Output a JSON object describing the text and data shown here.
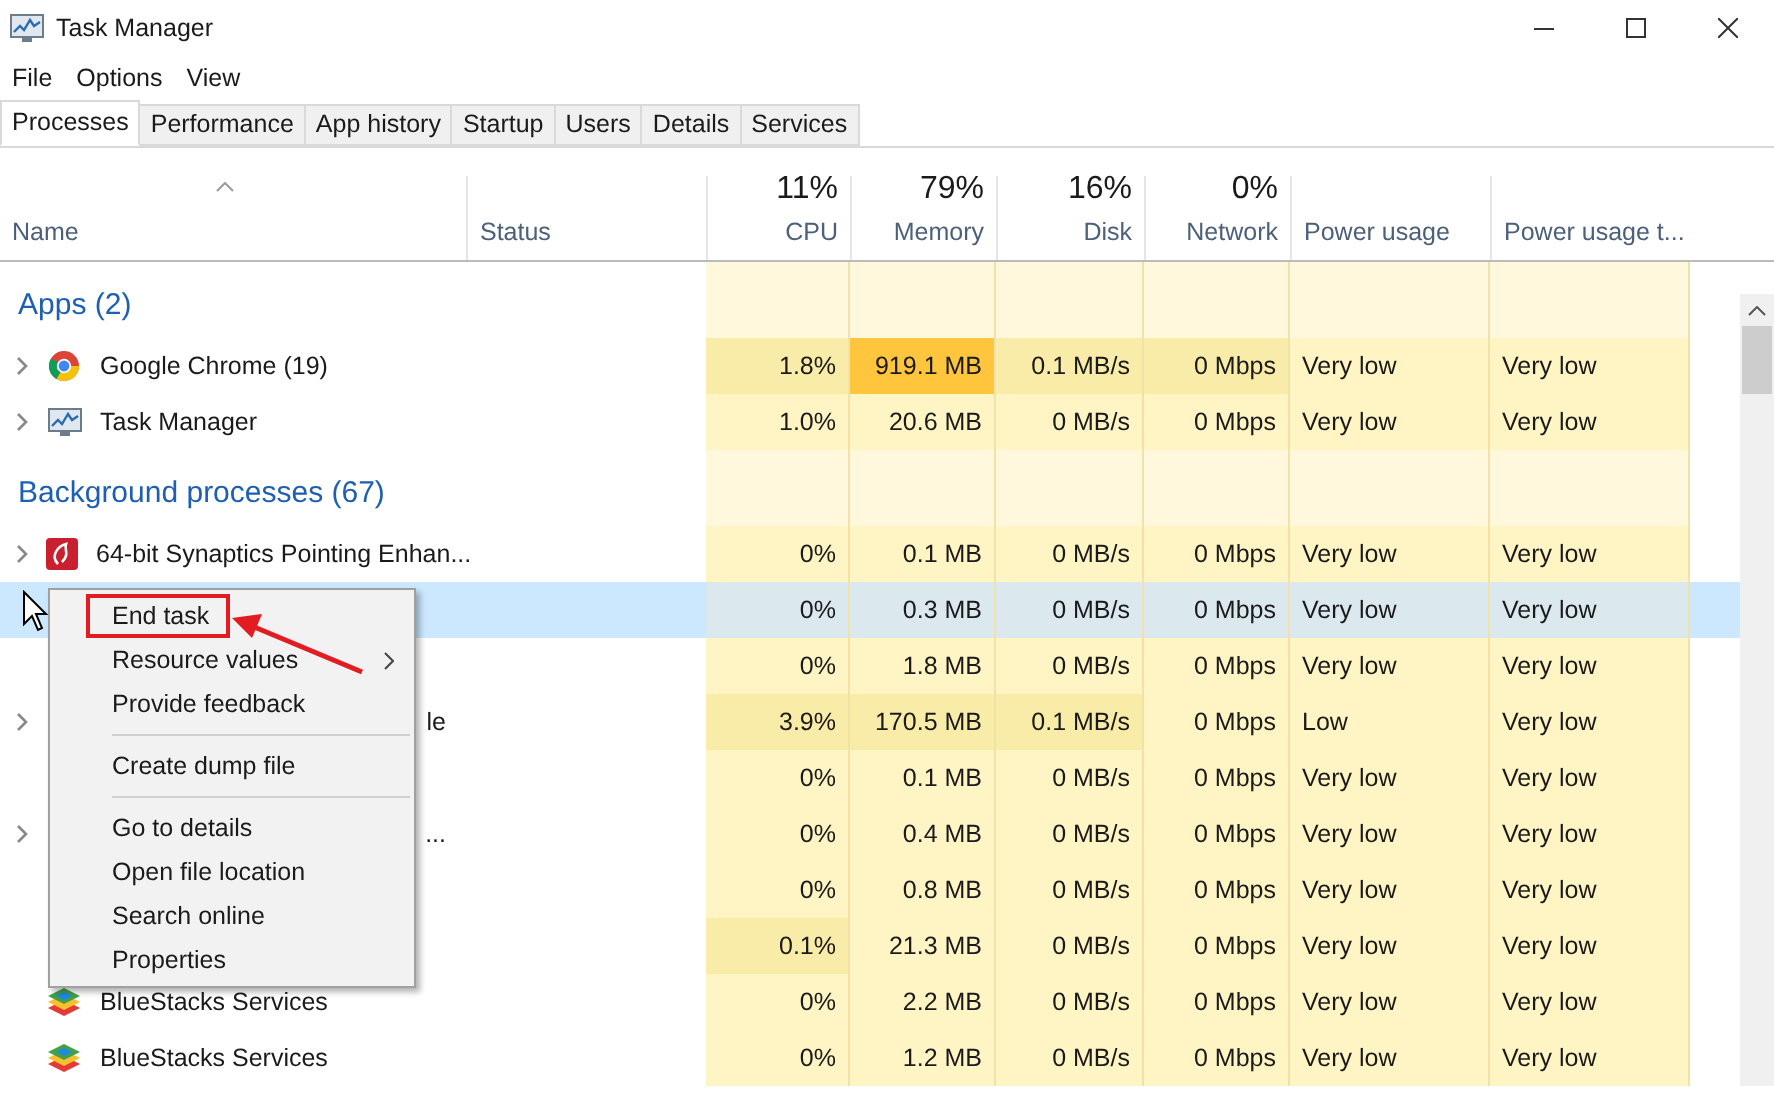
{
  "window": {
    "title": "Task Manager"
  },
  "menu": [
    "File",
    "Options",
    "View"
  ],
  "tabs": [
    {
      "label": "Processes",
      "selected": true
    },
    {
      "label": "Performance",
      "selected": false
    },
    {
      "label": "App history",
      "selected": false
    },
    {
      "label": "Startup",
      "selected": false
    },
    {
      "label": "Users",
      "selected": false
    },
    {
      "label": "Details",
      "selected": false
    },
    {
      "label": "Services",
      "selected": false
    }
  ],
  "columns": [
    {
      "label": "Name"
    },
    {
      "label": "Status"
    },
    {
      "summary": "11%",
      "label": "CPU"
    },
    {
      "summary": "79%",
      "label": "Memory"
    },
    {
      "summary": "16%",
      "label": "Disk"
    },
    {
      "summary": "0%",
      "label": "Network"
    },
    {
      "label": "Power usage"
    },
    {
      "label": "Power usage t..."
    }
  ],
  "groups": [
    {
      "title": "Apps (2)",
      "rows": [
        {
          "kind": "browser",
          "name": "Google Chrome (19)",
          "expandable": true,
          "selected": false,
          "cells": [
            {
              "text": "1.8%",
              "busy": true,
              "peak": false
            },
            {
              "text": "919.1 MB",
              "peak": true
            },
            {
              "text": "0.1 MB/s",
              "busy": true,
              "peak": false
            },
            {
              "text": "0 Mbps",
              "busy": true,
              "peak": false
            },
            {
              "text": "Very low",
              "busy": false,
              "peak": false
            },
            {
              "text": "Very low",
              "busy": false,
              "peak": false
            }
          ]
        },
        {
          "kind": "monitor",
          "name": "Task Manager",
          "expandable": true,
          "selected": false,
          "cells": [
            {
              "text": "1.0%",
              "busy": false,
              "peak": false
            },
            {
              "text": "20.6 MB",
              "busy": false,
              "peak": false
            },
            {
              "text": "0 MB/s",
              "busy": false,
              "peak": false
            },
            {
              "text": "0 Mbps",
              "busy": false,
              "peak": false
            },
            {
              "text": "Very low",
              "busy": false,
              "peak": false
            },
            {
              "text": "Very low",
              "busy": false,
              "peak": false
            }
          ]
        }
      ]
    },
    {
      "title": "Background processes (67)",
      "rows": [
        {
          "kind": "driver",
          "name": "64-bit Synaptics Pointing Enhan...",
          "expandable": true,
          "selected": false,
          "cells": [
            {
              "text": "0%",
              "busy": false,
              "peak": false
            },
            {
              "text": "0.1 MB",
              "busy": false,
              "peak": false
            },
            {
              "text": "0 MB/s",
              "busy": false,
              "peak": false
            },
            {
              "text": "0 Mbps",
              "busy": false,
              "peak": false
            },
            {
              "text": "Very low",
              "busy": false,
              "peak": false
            },
            {
              "text": "Very low",
              "busy": false,
              "peak": false
            }
          ]
        },
        {
          "kind": "covered",
          "expandable": false,
          "selected": true,
          "cells": [
            {
              "text": "0%"
            },
            {
              "text": "0.3 MB"
            },
            {
              "text": "0 MB/s"
            },
            {
              "text": "0 Mbps"
            },
            {
              "text": "Very low"
            },
            {
              "text": "Very low"
            }
          ]
        },
        {
          "kind": "covered",
          "expandable": false,
          "selected": false,
          "cells": [
            {
              "text": "0%",
              "busy": false,
              "peak": false
            },
            {
              "text": "1.8 MB",
              "busy": false,
              "peak": false
            },
            {
              "text": "0 MB/s",
              "busy": false,
              "peak": false
            },
            {
              "text": "0 Mbps",
              "busy": false,
              "peak": false
            },
            {
              "text": "Very low",
              "busy": false,
              "peak": false
            },
            {
              "text": "Very low",
              "busy": false,
              "peak": false
            }
          ]
        },
        {
          "kind": "covered",
          "name": "le",
          "expandable": true,
          "selected": false,
          "cells": [
            {
              "text": "3.9%",
              "busy": true,
              "peak": false
            },
            {
              "text": "170.5 MB",
              "busy": true,
              "peak": false
            },
            {
              "text": "0.1 MB/s",
              "busy": true,
              "peak": false
            },
            {
              "text": "0 Mbps",
              "busy": false,
              "peak": false
            },
            {
              "text": "Low",
              "busy": false,
              "peak": false
            },
            {
              "text": "Very low",
              "busy": false,
              "peak": false
            }
          ]
        },
        {
          "kind": "covered",
          "expandable": false,
          "selected": false,
          "cells": [
            {
              "text": "0%",
              "busy": false,
              "peak": false
            },
            {
              "text": "0.1 MB",
              "busy": false,
              "peak": false
            },
            {
              "text": "0 MB/s",
              "busy": false,
              "peak": false
            },
            {
              "text": "0 Mbps",
              "busy": false,
              "peak": false
            },
            {
              "text": "Very low",
              "busy": false,
              "peak": false
            },
            {
              "text": "Very low",
              "busy": false,
              "peak": false
            }
          ]
        },
        {
          "kind": "covered",
          "name": "...",
          "expandable": true,
          "selected": false,
          "cells": [
            {
              "text": "0%",
              "busy": false,
              "peak": false
            },
            {
              "text": "0.4 MB",
              "busy": false,
              "peak": false
            },
            {
              "text": "0 MB/s",
              "busy": false,
              "peak": false
            },
            {
              "text": "0 Mbps",
              "busy": false,
              "peak": false
            },
            {
              "text": "Very low",
              "busy": false,
              "peak": false
            },
            {
              "text": "Very low",
              "busy": false,
              "peak": false
            }
          ]
        },
        {
          "kind": "covered",
          "expandable": false,
          "selected": false,
          "cells": [
            {
              "text": "0%",
              "busy": false,
              "peak": false
            },
            {
              "text": "0.8 MB",
              "busy": false,
              "peak": false
            },
            {
              "text": "0 MB/s",
              "busy": false,
              "peak": false
            },
            {
              "text": "0 Mbps",
              "busy": false,
              "peak": false
            },
            {
              "text": "Very low",
              "busy": false,
              "peak": false
            },
            {
              "text": "Very low",
              "busy": false,
              "peak": false
            }
          ]
        },
        {
          "kind": "covered",
          "expandable": false,
          "selected": false,
          "cells": [
            {
              "text": "0.1%",
              "busy": true,
              "peak": false
            },
            {
              "text": "21.3 MB",
              "busy": false,
              "peak": false
            },
            {
              "text": "0 MB/s",
              "busy": false,
              "peak": false
            },
            {
              "text": "0 Mbps",
              "busy": false,
              "peak": false
            },
            {
              "text": "Very low",
              "busy": false,
              "peak": false
            },
            {
              "text": "Very low",
              "busy": false,
              "peak": false
            }
          ]
        },
        {
          "kind": "emulator",
          "name": "BlueStacks Services",
          "expandable": false,
          "selected": false,
          "cells": [
            {
              "text": "0%",
              "busy": false,
              "peak": false
            },
            {
              "text": "2.2 MB",
              "busy": false,
              "peak": false
            },
            {
              "text": "0 MB/s",
              "busy": false,
              "peak": false
            },
            {
              "text": "0 Mbps",
              "busy": false,
              "peak": false
            },
            {
              "text": "Very low",
              "busy": false,
              "peak": false
            },
            {
              "text": "Very low",
              "busy": false,
              "peak": false
            }
          ]
        },
        {
          "kind": "emulator",
          "name": "BlueStacks Services",
          "expandable": false,
          "selected": false,
          "cells": [
            {
              "text": "0%",
              "busy": false,
              "peak": false
            },
            {
              "text": "1.2 MB",
              "busy": false,
              "peak": false
            },
            {
              "text": "0 MB/s",
              "busy": false,
              "peak": false
            },
            {
              "text": "0 Mbps",
              "busy": false,
              "peak": false
            },
            {
              "text": "Very low",
              "busy": false,
              "peak": false
            },
            {
              "text": "Very low",
              "busy": false,
              "peak": false
            }
          ]
        }
      ]
    }
  ],
  "context_menu": {
    "items": [
      {
        "kind": "item",
        "label": "End task",
        "submenu": false,
        "annotated": true
      },
      {
        "kind": "item",
        "label": "Resource values",
        "submenu": true,
        "annotated": false
      },
      {
        "kind": "item",
        "label": "Provide feedback",
        "submenu": false,
        "annotated": false
      },
      {
        "kind": "separator"
      },
      {
        "kind": "item",
        "label": "Create dump file",
        "submenu": false,
        "annotated": false
      },
      {
        "kind": "separator"
      },
      {
        "kind": "item",
        "label": "Go to details",
        "submenu": false,
        "annotated": false
      },
      {
        "kind": "item",
        "label": "Open file location",
        "submenu": false,
        "annotated": false
      },
      {
        "kind": "item",
        "label": "Search online",
        "submenu": false,
        "annotated": false
      },
      {
        "kind": "item",
        "label": "Properties",
        "submenu": false,
        "annotated": false
      }
    ]
  }
}
